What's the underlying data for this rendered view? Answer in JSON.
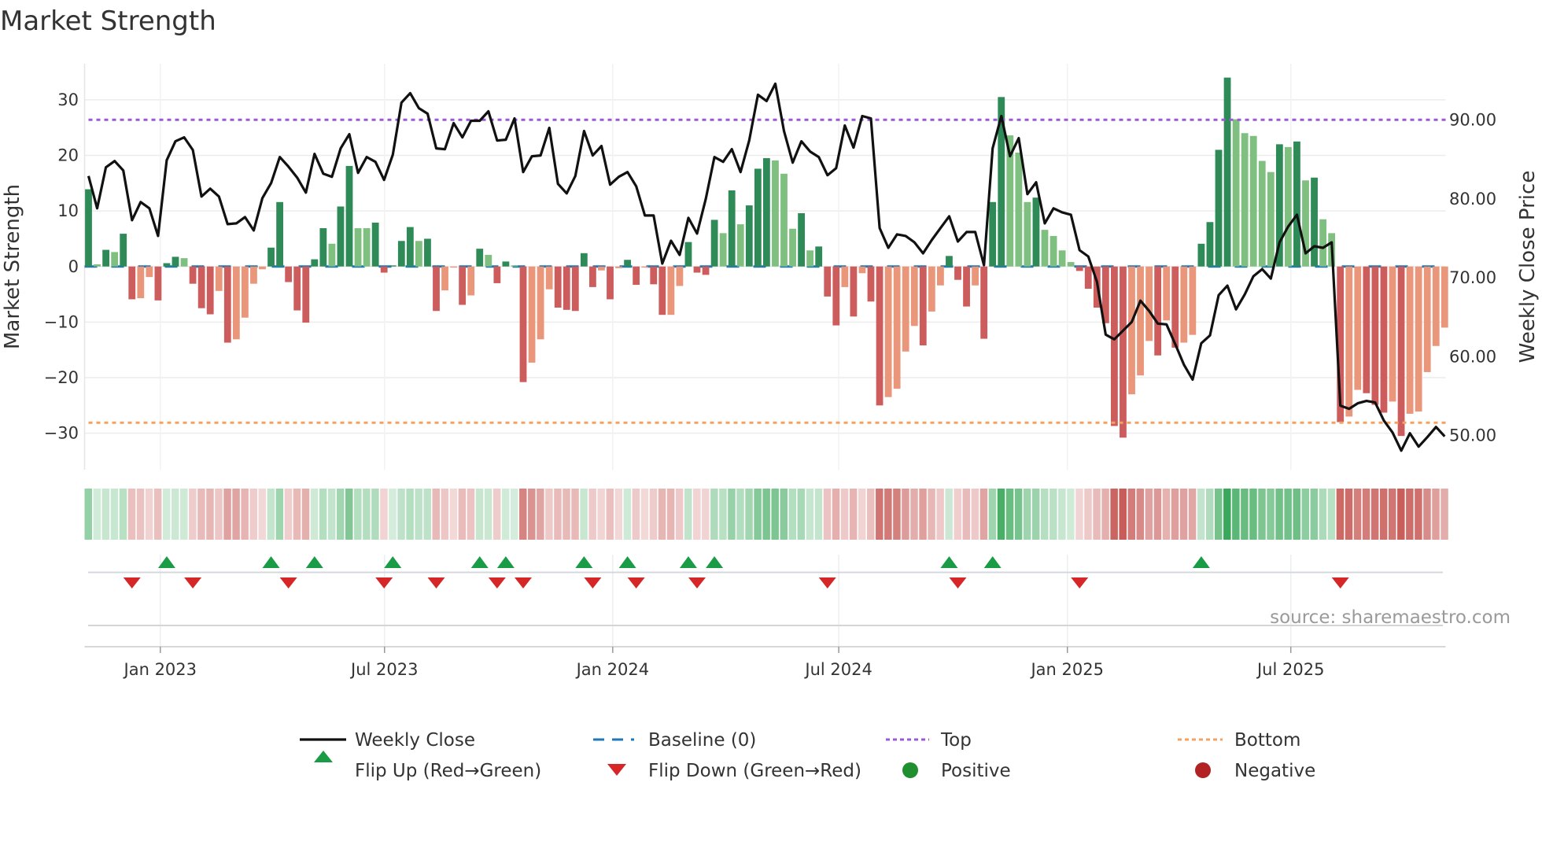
{
  "title": "Market Strength",
  "source": "source: sharemaestro.com",
  "chart_data": {
    "type": "bar+line",
    "title": "Market Strength",
    "ylabel": "Market Strength",
    "y2label": "Weekly Close Price",
    "ylim": [
      -36.6,
      36.5
    ],
    "y2lim": [
      45.6,
      97.1
    ],
    "yticks": [
      "30",
      "20",
      "10",
      "0",
      "−10",
      "−20",
      "−30"
    ],
    "ytick_values": [
      30,
      20,
      10,
      0,
      -10,
      -20,
      -30
    ],
    "y2ticks": [
      "90.00",
      "80.00",
      "70.00",
      "60.00",
      "50.00"
    ],
    "y2tick_values": [
      90,
      80,
      70,
      60,
      50
    ],
    "xticks": [
      "Jan 2023",
      "Jul 2023",
      "Jan 2024",
      "Jul 2024",
      "Jan 2025",
      "Jul 2025"
    ],
    "xtick_week_index": [
      8.26,
      34.05,
      60.3,
      86.3,
      112.6,
      138.3
    ],
    "top_level": 26.4,
    "bottom_level": -28.1,
    "baseline": 0,
    "colors": {
      "pos_strong": "#2e8b57",
      "pos_weak": "#7fbf7f",
      "neg_strong": "#cd5c5c",
      "neg_weak": "#e9967a",
      "line": "#111111",
      "baseline": "#1f77b4",
      "top": "#9b59d6",
      "bottom": "#f4a261",
      "flip_up": "#1a9c47",
      "flip_down": "#d62728",
      "strip_pos": "#3aa85a",
      "strip_neg": "#c4504c",
      "positive": "#1f8f2f",
      "negative": "#b22222"
    },
    "strength": [
      13.9,
      0.4,
      3.0,
      2.6,
      5.9,
      -5.9,
      -5.7,
      -1.9,
      -6.1,
      0.6,
      1.75,
      1.5,
      -3.1,
      -7.5,
      -8.6,
      -4.4,
      -13.7,
      -13.1,
      -9.2,
      -3.1,
      -0.5,
      3.4,
      11.6,
      -2.8,
      -7.9,
      -10.1,
      1.3,
      6.9,
      4.1,
      10.8,
      18.1,
      6.9,
      6.9,
      7.9,
      -1.1,
      0.2,
      4.6,
      7.1,
      4.6,
      5.0,
      -8.0,
      -4.3,
      -0.2,
      -6.9,
      -5.2,
      3.2,
      2.1,
      -3.0,
      0.9,
      0.2,
      -20.8,
      -17.3,
      -13.1,
      -4.1,
      -7.4,
      -7.8,
      -8.0,
      2.4,
      -3.7,
      -0.7,
      -5.9,
      -0.3,
      1.2,
      -3.3,
      -0.2,
      -3.2,
      -8.7,
      -8.7,
      -3.5,
      4.4,
      -1.1,
      -1.5,
      8.4,
      6.0,
      13.7,
      7.6,
      11.0,
      17.6,
      19.5,
      19.1,
      16.7,
      6.8,
      9.6,
      2.9,
      3.6,
      -5.4,
      -10.6,
      -3.7,
      -9.0,
      -1.2,
      -6.3,
      -25.0,
      -23.5,
      -22.0,
      -15.3,
      -10.7,
      -14.2,
      -8.1,
      -3.4,
      1.9,
      -2.4,
      -7.2,
      -3.4,
      -13.0,
      11.6,
      30.5,
      23.6,
      20.5,
      11.6,
      12.4,
      6.6,
      5.5,
      2.9,
      0.8,
      -0.8,
      -4.0,
      -7.4,
      -10.2,
      -28.7,
      -30.8,
      -23.0,
      -19.6,
      -13.4,
      -16.0,
      -9.7,
      -14.6,
      -13.7,
      -12.3,
      4.1,
      8.0,
      21.0,
      34.0,
      26.5,
      24.0,
      23.5,
      19.0,
      17.0,
      22.0,
      21.5,
      22.5,
      15.5,
      16.0,
      8.5,
      6.0,
      -28.0,
      -27.0,
      -22.2,
      -22.8,
      -24.9,
      -26.3,
      -24.3,
      -30.5,
      -26.5,
      -26.1,
      -19.0,
      -14.3,
      -11.0
    ],
    "close": [
      82.9,
      78.8,
      84.0,
      84.8,
      83.6,
      77.3,
      79.6,
      78.8,
      75.3,
      84.9,
      87.3,
      87.8,
      86.2,
      80.3,
      81.3,
      80.3,
      76.8,
      76.9,
      77.7,
      76.0,
      80.1,
      82.0,
      85.3,
      84.1,
      82.7,
      80.8,
      85.7,
      83.2,
      82.8,
      86.4,
      88.2,
      83.3,
      85.3,
      84.7,
      82.4,
      85.6,
      92.2,
      93.4,
      91.5,
      90.8,
      86.4,
      86.3,
      89.6,
      87.8,
      89.9,
      89.9,
      91.1,
      87.4,
      87.5,
      90.2,
      83.4,
      85.4,
      85.5,
      89.0,
      81.9,
      80.7,
      82.9,
      88.6,
      85.5,
      86.7,
      81.8,
      82.8,
      83.4,
      81.6,
      77.9,
      77.9,
      71.8,
      74.7,
      72.9,
      77.6,
      75.6,
      80.0,
      85.3,
      84.7,
      86.3,
      83.4,
      87.4,
      93.2,
      92.4,
      94.6,
      88.6,
      84.6,
      87.3,
      86.0,
      85.3,
      83.0,
      83.9,
      89.3,
      86.5,
      90.5,
      90.2,
      76.3,
      73.8,
      75.5,
      75.3,
      74.5,
      73.1,
      74.8,
      76.3,
      77.8,
      74.6,
      75.8,
      75.8,
      71.6,
      86.4,
      90.5,
      85.4,
      87.7,
      80.6,
      82.1,
      76.9,
      78.8,
      78.3,
      78.0,
      73.5,
      72.7,
      69.5,
      62.8,
      62.2,
      63.3,
      64.4,
      67.1,
      65.8,
      64.2,
      64.1,
      61.6,
      59.0,
      57.1,
      61.7,
      62.7,
      67.8,
      69.0,
      66.0,
      67.9,
      70.2,
      71.1,
      69.9,
      74.5,
      76.5,
      78.0,
      73.1,
      74.0,
      73.8,
      74.5,
      53.8,
      53.4,
      54.1,
      54.4,
      54.2,
      51.9,
      50.4,
      48.1,
      50.3,
      48.6,
      49.8,
      51.1,
      49.9
    ],
    "legend": {
      "placement": "bottom",
      "weekly_close": "Weekly Close",
      "baseline": "Baseline (0)",
      "top": "Top",
      "bottom": "Bottom",
      "flip_up": "Flip Up (Red→Green)",
      "flip_down": "Flip Down (Green→Red)",
      "positive": "Positive",
      "negative": "Negative"
    }
  }
}
